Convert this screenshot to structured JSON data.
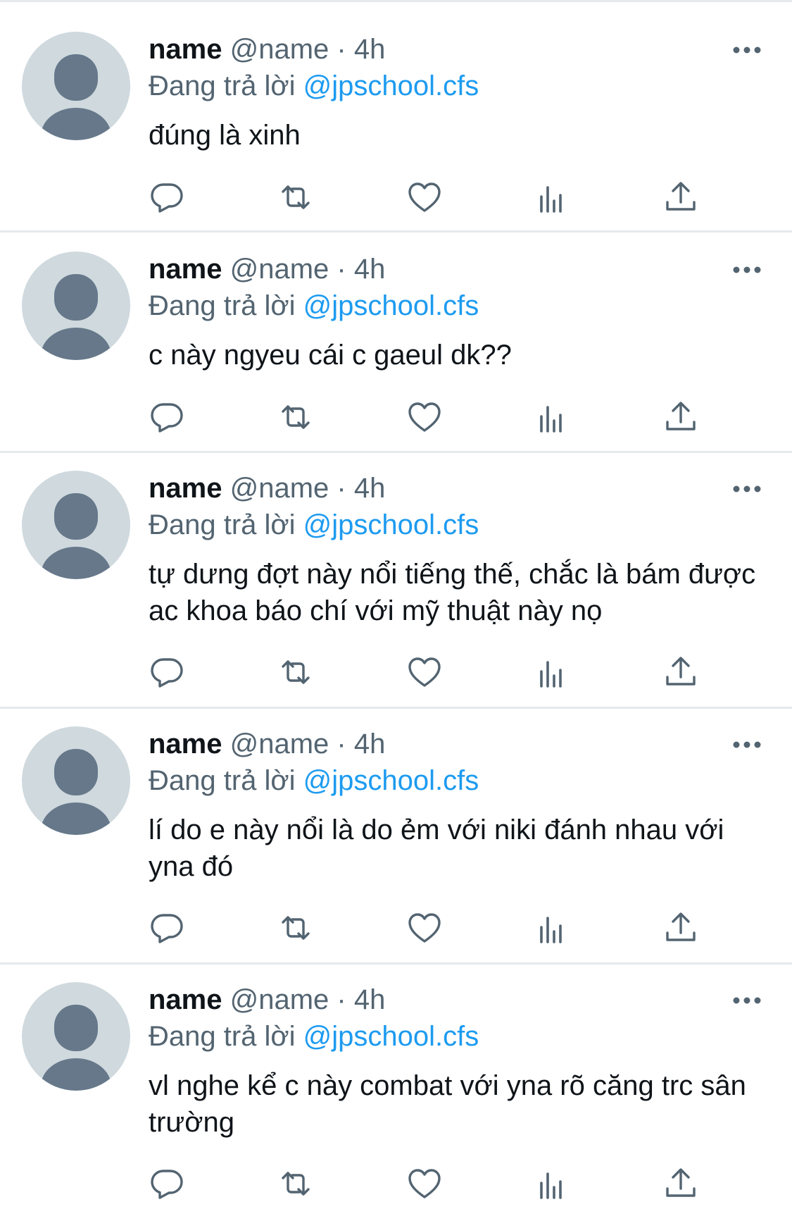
{
  "replies": [
    {
      "display_name": "name",
      "handle": "@name",
      "separator": "·",
      "time": "4h",
      "reply_prefix": "Đang trả lời",
      "mention": "@jpschool.cfs",
      "text": "đúng là xinh"
    },
    {
      "display_name": "name",
      "handle": "@name",
      "separator": "·",
      "time": "4h",
      "reply_prefix": "Đang trả lời",
      "mention": "@jpschool.cfs",
      "text": "c này ngyeu cái c gaeul dk??"
    },
    {
      "display_name": "name",
      "handle": "@name",
      "separator": "·",
      "time": "4h",
      "reply_prefix": "Đang trả lời",
      "mention": "@jpschool.cfs",
      "text": "tự dưng đợt này nổi tiếng thế, chắc là bám được ac khoa báo chí với mỹ thuật này nọ"
    },
    {
      "display_name": "name",
      "handle": "@name",
      "separator": "·",
      "time": "4h",
      "reply_prefix": "Đang trả lời",
      "mention": "@jpschool.cfs",
      "text": "lí do e này nổi là do ẻm với niki đánh nhau với yna đó"
    },
    {
      "display_name": "name",
      "handle": "@name",
      "separator": "·",
      "time": "4h",
      "reply_prefix": "Đang trả lời",
      "mention": "@jpschool.cfs",
      "text": "vl nghe kể c này combat với yna rõ căng trc sân trường"
    }
  ],
  "icons": {
    "reply": "speech-bubble-icon",
    "retweet": "retweet-arrows-icon",
    "like": "heart-icon",
    "views": "bar-chart-icon",
    "share": "upload-arrow-icon",
    "more": "ellipsis-icon"
  },
  "colors": {
    "text": "#0f1419",
    "secondary": "#536471",
    "mention": "#1d9bf0",
    "divider": "#e6e9eb",
    "avatar_bg": "#cfd9de",
    "avatar_fg": "#66788a"
  }
}
